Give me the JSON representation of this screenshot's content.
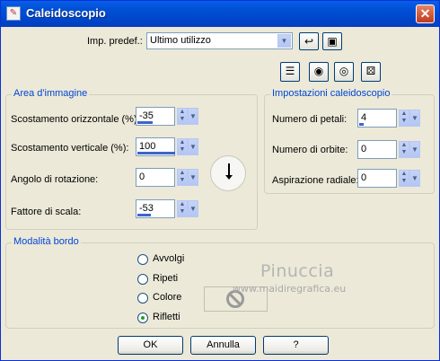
{
  "window": {
    "title": "Caleidoscopio",
    "close_glyph": "✕"
  },
  "preset": {
    "label": "Imp. predef.:",
    "value": "Ultimo utilizzo",
    "icons": [
      "reset-icon",
      "save-icon"
    ]
  },
  "toolbar": {
    "icons": [
      "layout-icon",
      "eye-hand-icon",
      "eye-icon",
      "dice-icon"
    ]
  },
  "image_area": {
    "title": "Area d'immagine",
    "fields": [
      {
        "label": "Scostamento orizzontale (%):",
        "value": "-35",
        "fill": 0.4
      },
      {
        "label": "Scostamento verticale (%):",
        "value": "100",
        "fill": 1.0
      },
      {
        "label": "Angolo di rotazione:",
        "value": "0",
        "fill": 0.0
      },
      {
        "label": "Fattore di scala:",
        "value": "-53",
        "fill": 0.35
      }
    ],
    "dial_icon": "rotation-dial-icon"
  },
  "kaleido": {
    "title": "Impostazioni caleidoscopio",
    "fields": [
      {
        "label": "Numero di petali:",
        "value": "4",
        "fill": 0.12
      },
      {
        "label": "Numero di orbite:",
        "value": "0",
        "fill": 0.0
      },
      {
        "label": "Aspirazione radiale:",
        "value": "0",
        "fill": 0.0
      }
    ]
  },
  "edge_mode": {
    "title": "Modalità bordo",
    "options": [
      {
        "label": "Avvolgi",
        "checked": false
      },
      {
        "label": "Ripeti",
        "checked": false
      },
      {
        "label": "Colore",
        "checked": false
      },
      {
        "label": "Rifletti",
        "checked": true
      }
    ]
  },
  "watermark": {
    "line1": "Pinuccia",
    "line2": "www.maidiregrafica.eu"
  },
  "buttons": {
    "ok": "OK",
    "cancel": "Annulla",
    "help": "?"
  },
  "colors": {
    "titlebar": "#0054e3",
    "group_title": "#0046d5",
    "face": "#ece9d8"
  }
}
